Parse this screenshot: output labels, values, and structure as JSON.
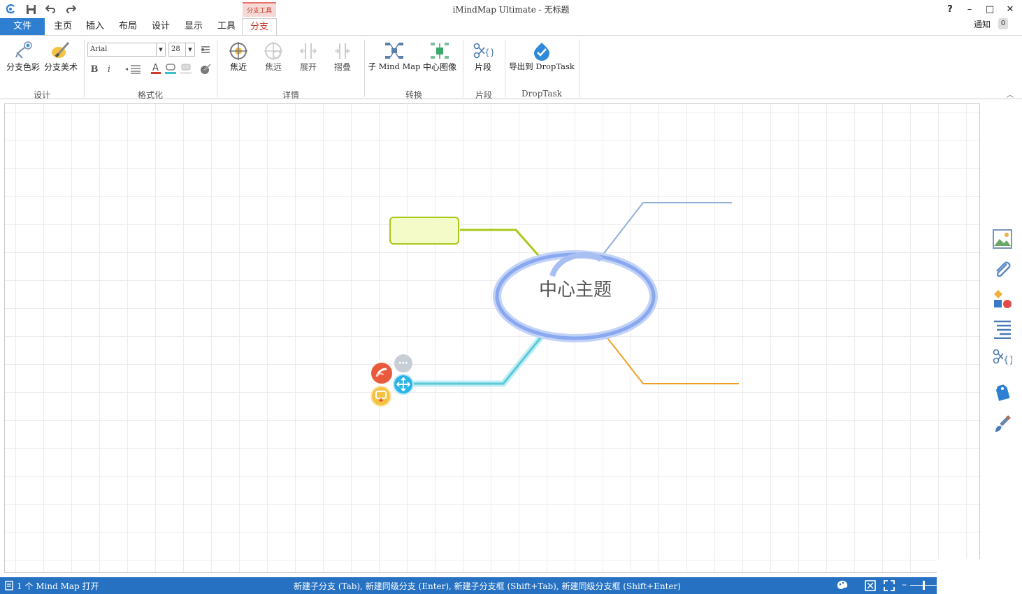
{
  "window": {
    "title": "iMindMap Ultimate - 无标题",
    "help": "?",
    "minimize": "–",
    "maximize": "□",
    "close": "✕"
  },
  "tabs": {
    "file": "文件",
    "home": "主页",
    "insert": "插入",
    "layout": "布局",
    "design": "设计",
    "display": "显示",
    "tools": "工具",
    "branch": "分支",
    "context_group": "分支工具"
  },
  "notify": {
    "label": "通知",
    "count": "0"
  },
  "ribbon": {
    "design_group": {
      "label": "设计",
      "branch_color": "分支色彩",
      "branch_art": "分支美术"
    },
    "format_group": {
      "label": "格式化",
      "font": "Arial",
      "size": "28",
      "bold": "B",
      "italic": "i"
    },
    "detail_group": {
      "label": "详情",
      "focus_in": "焦近",
      "focus_out": "焦远",
      "expand": "展开",
      "collapse": "摺叠"
    },
    "convert_group": {
      "label": "转换",
      "sub_map": "子 Mind Map",
      "central_image": "中心图像"
    },
    "snippet_group": {
      "label": "片段",
      "snippet": "片段"
    },
    "droptask_group": {
      "label": "DropTask",
      "export": "导出到 DropTask"
    }
  },
  "canvas": {
    "central_topic": "中心主题"
  },
  "status": {
    "open_maps": "1 个 Mind Map 打开",
    "hint": "新建子分支 (Tab), 新建同级分支 (Enter), 新建子分支框 (Shift+Tab), 新建同级分支框 (Shift+Enter)"
  },
  "colors": {
    "file_tab": "#2e7fd2",
    "status_bar": "#2671c2",
    "central_ring": "#8aa8f0",
    "branch_green": "#a8c81a",
    "branch_blue": "#8fb0d8",
    "branch_cyan": "#5cc8d8",
    "branch_orange": "#f0a020"
  }
}
